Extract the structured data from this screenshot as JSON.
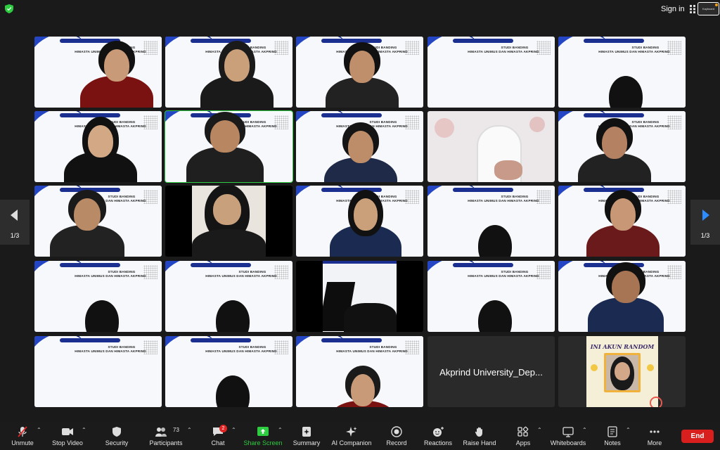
{
  "topbar": {
    "sign_in": "Sign in",
    "self_view_label": "Kayboard"
  },
  "slide": {
    "line1": "STUDI BANDING",
    "line2": "HIMASTA UNIMUS DAN HIMASTA AKPRIND"
  },
  "named_tile": {
    "name": "Akprind University_Dep..."
  },
  "cartoon_tile": {
    "title": "INI AKUN RANDOM"
  },
  "pagination": {
    "left": "1/3",
    "right": "1/3"
  },
  "toolbar": {
    "unmute": "Unmute",
    "stop_video": "Stop Video",
    "security": "Security",
    "participants": "Participants",
    "participants_count": "73",
    "chat": "Chat",
    "chat_badge": "2",
    "share_screen": "Share Screen",
    "summary": "Summary",
    "ai_companion": "AI Companion",
    "record": "Record",
    "reactions": "Reactions",
    "raise_hand": "Raise Hand",
    "apps": "Apps",
    "whiteboards": "Whiteboards",
    "notes": "Notes",
    "more": "More",
    "end": "End"
  },
  "colors": {
    "speaking_border": "#2ecc40",
    "end_button": "#d91e1e",
    "share_green": "#2ecc40",
    "slide_blue": "#2446c4"
  }
}
